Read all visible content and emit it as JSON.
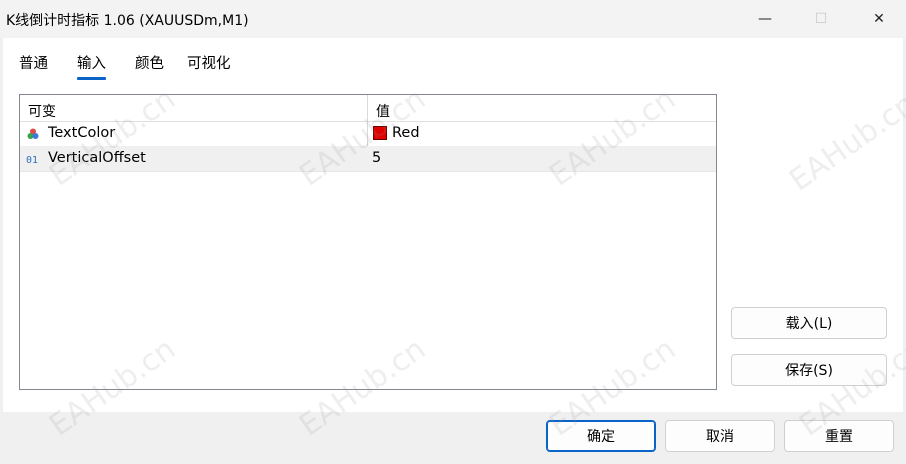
{
  "window": {
    "title": "K线倒计时指标 1.06 (XAUUSDm,M1)",
    "minimize_glyph": "—",
    "maximize_glyph": "☐",
    "close_glyph": "✕"
  },
  "tabs": [
    {
      "label": "普通",
      "active": false
    },
    {
      "label": "输入",
      "active": true
    },
    {
      "label": "颜色",
      "active": false
    },
    {
      "label": "可视化",
      "active": false
    }
  ],
  "table": {
    "headers": {
      "variable": "可变",
      "value": "值"
    },
    "rows": [
      {
        "icon": "color-palette-icon",
        "name": "TextColor",
        "value": "Red",
        "swatch_color": "#e00000"
      },
      {
        "icon": "numeric-01-icon",
        "name": "VerticalOffset",
        "value": "5"
      }
    ]
  },
  "side_buttons": {
    "load": "载入(L)",
    "save": "保存(S)"
  },
  "footer": {
    "ok": "确定",
    "cancel": "取消",
    "reset": "重置"
  },
  "watermark": "EAHub.cn",
  "colors": {
    "accent": "#0a64c8",
    "swatch_red": "#e00000"
  }
}
